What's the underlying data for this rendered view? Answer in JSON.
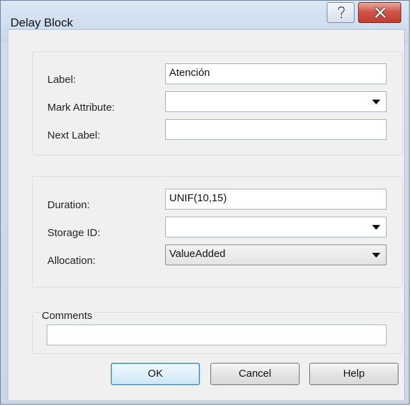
{
  "window": {
    "title": "Delay Block"
  },
  "titlebar": {
    "help_icon": "question-icon",
    "close_icon": "close-x-icon"
  },
  "group1": {
    "label_caption": "Label:",
    "label_value": "Atención",
    "mark_attribute_caption": "Mark Attribute:",
    "mark_attribute_value": "",
    "next_label_caption": "Next Label:",
    "next_label_value": ""
  },
  "group2": {
    "duration_caption": "Duration:",
    "duration_value": "UNIF(10,15)",
    "storage_id_caption": "Storage ID:",
    "storage_id_value": "",
    "allocation_caption": "Allocation:",
    "allocation_value": "ValueAdded"
  },
  "comments": {
    "legend": "Comments",
    "value": ""
  },
  "buttons": {
    "ok": "OK",
    "cancel": "Cancel",
    "help": "Help"
  },
  "colors": {
    "close_button": "#c23c2e",
    "default_button_border": "#3c7fb1"
  }
}
